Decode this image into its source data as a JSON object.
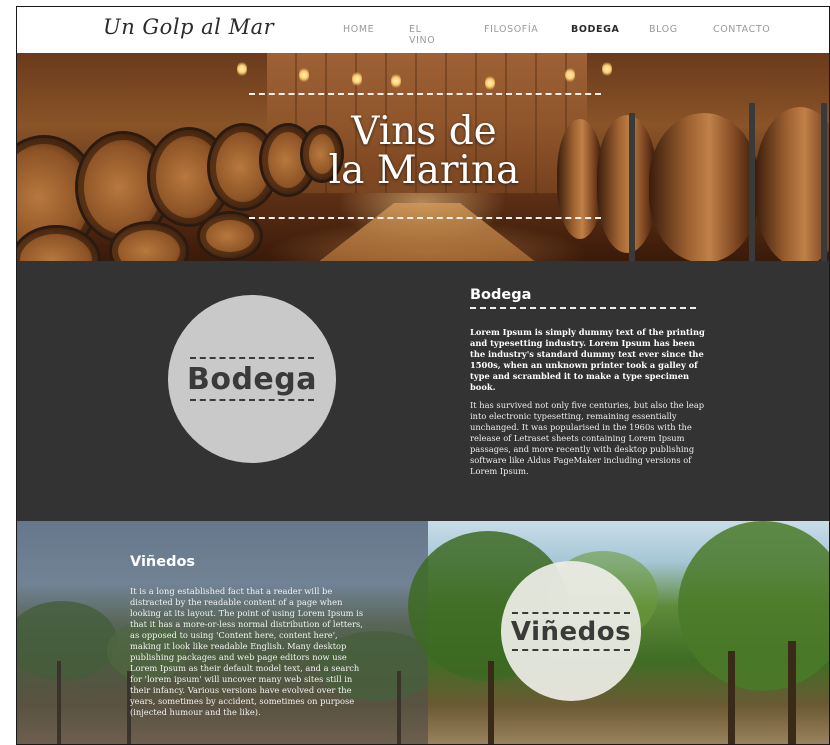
{
  "nav": {
    "logo": "Un Golp al Mar",
    "links": [
      "HOME",
      "EL VINO",
      "FILOSOFÍA",
      "BODEGA",
      "BLOG",
      "CONTACTO"
    ],
    "active_index": 3
  },
  "hero": {
    "title_line1": "Vins de",
    "title_line2": "la Marina"
  },
  "bodega": {
    "circle_label": "Bodega",
    "heading": "Bodega",
    "intro": "Lorem Ipsum is simply dummy text of the printing and typesetting industry. Lorem Ipsum has been the industry's standard dummy text ever since the 1500s, when an unknown printer took a galley of type and scrambled it to make a type specimen book.",
    "body": "It has survived not only five centuries, but also the leap into electronic typesetting, remaining essentially unchanged. It was popularised in the 1960s with the release of Letraset sheets containing Lorem Ipsum passages, and more recently with desktop publishing software like Aldus PageMaker including versions of Lorem Ipsum."
  },
  "vinedos": {
    "heading": "Viñedos",
    "body": "It is a long established fact that a reader will be distracted by the readable content of a page when looking at its layout. The point of using Lorem Ipsum is that it has a more-or-less normal distribution of letters, as opposed to using 'Content here, content here', making it look like readable English. Many desktop publishing packages and web page editors now use Lorem Ipsum as their default model text, and a search for 'lorem ipsum' will uncover many web sites still in their infancy. Various versions have evolved over the years, sometimes by accident, sometimes on purpose (injected humour and the like).",
    "circle_label": "Viñedos"
  },
  "colors": {
    "nav_bg": "#ffffff",
    "nav_active": "#2a2a2a",
    "nav_inactive": "#9a9a9a",
    "dark_section": "#333333",
    "grey_circle": "#c9c9c9",
    "white_circle": "#eeeee8"
  }
}
